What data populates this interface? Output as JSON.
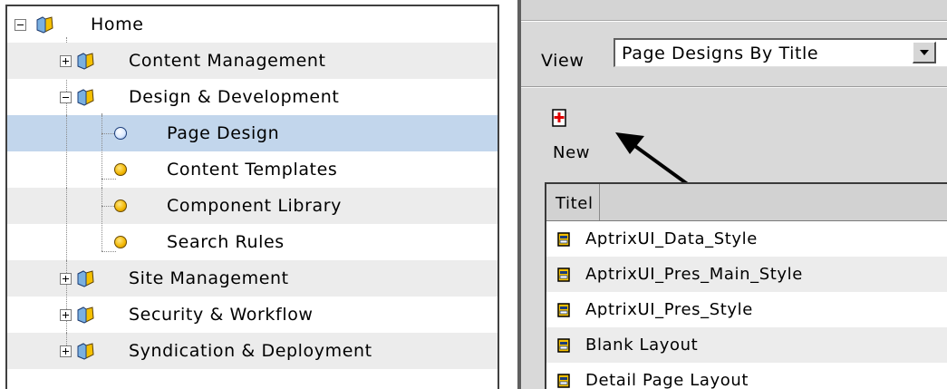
{
  "tree": {
    "root": {
      "label": "Home"
    },
    "items": [
      {
        "label": "Content Management",
        "expander": "plus"
      },
      {
        "label": "Design & Development",
        "expander": "minus"
      },
      {
        "label": "Page Design",
        "selected": true
      },
      {
        "label": "Content Templates"
      },
      {
        "label": "Component Library"
      },
      {
        "label": "Search Rules"
      },
      {
        "label": "Site Management",
        "expander": "plus"
      },
      {
        "label": "Security & Workflow",
        "expander": "plus"
      },
      {
        "label": "Syndication & Deployment",
        "expander": "plus"
      }
    ]
  },
  "view": {
    "label": "View",
    "selected": "Page Designs By Title"
  },
  "toolbar": {
    "new_label": "New"
  },
  "table": {
    "header": "Titel",
    "rows": [
      "AptrixUI_Data_Style",
      "AptrixUI_Pres_Main_Style",
      "AptrixUI_Pres_Style",
      "Blank Layout",
      "Detail Page Layout"
    ]
  },
  "colors": {
    "selection": "#c2d6ec",
    "row_shade": "#ececec",
    "folder": "#f2b600",
    "toolbar_bg": "#d9d9d9"
  },
  "icons": {
    "folder": "folder-icon",
    "leaf": "circle-node-icon",
    "new": "new-document-icon",
    "row": "page-design-icon",
    "callout": "arrow-callout-icon"
  }
}
